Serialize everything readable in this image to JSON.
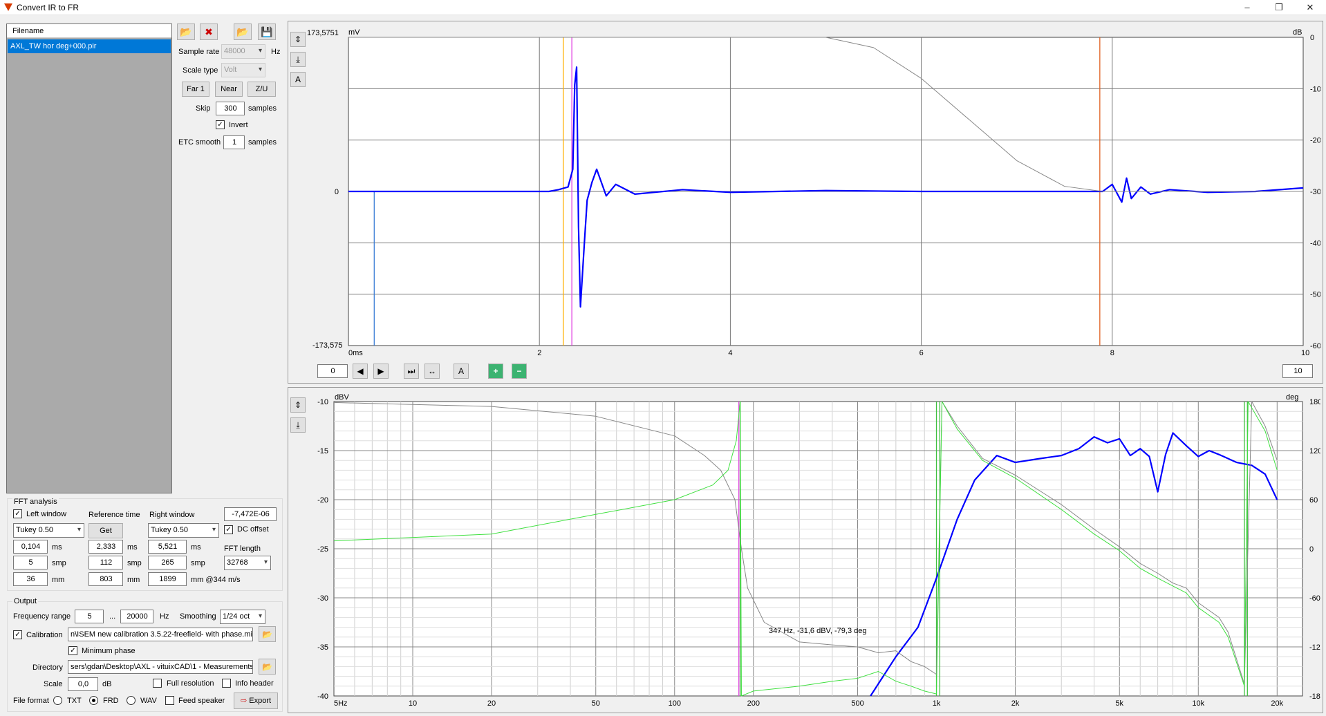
{
  "window": {
    "title": "Convert IR to FR",
    "min": "–",
    "restore": "❐",
    "close": "✕"
  },
  "file_list": {
    "header": "Filename",
    "items": [
      "AXL_TW hor deg+000.pir"
    ]
  },
  "toolbar": {
    "open": "📂",
    "remove": "✖",
    "open_folder": "📂",
    "save": "💾"
  },
  "params": {
    "sample_rate_label": "Sample rate",
    "sample_rate": "48000",
    "sample_rate_unit": "Hz",
    "scale_type_label": "Scale type",
    "scale_type": "Volt",
    "far1": "Far 1",
    "near": "Near",
    "zu": "Z/U",
    "skip_label": "Skip",
    "skip": "300",
    "skip_unit": "samples",
    "invert_label": "Invert",
    "invert_checked": true,
    "etc_label": "ETC smooth",
    "etc": "1",
    "etc_unit": "samples"
  },
  "fft": {
    "title": "FFT analysis",
    "left_window_label": "Left window",
    "left_window_checked": true,
    "reference_time_label": "Reference time",
    "right_window_label": "Right window",
    "dc_value": "-7,472E-06",
    "left_type": "Tukey 0.50",
    "get": "Get",
    "right_type": "Tukey 0.50",
    "dc_offset_label": "DC offset",
    "dc_offset_checked": true,
    "left_ms": "0,104",
    "ref_ms": "2,333",
    "right_ms": "5,521",
    "ms": "ms",
    "fft_length_label": "FFT length",
    "left_smp": "5",
    "ref_smp": "112",
    "right_smp": "265",
    "smp": "smp",
    "fft_length": "32768",
    "left_mm": "36",
    "ref_mm": "803",
    "right_mm": "1899",
    "mm": "mm",
    "mm_speed": "mm @344 m/s"
  },
  "output": {
    "title": "Output",
    "freq_range_label": "Frequency range",
    "freq_min": "5",
    "dots": "...",
    "freq_max": "20000",
    "hz": "Hz",
    "smoothing_label": "Smoothing",
    "smoothing": "1/24 oct",
    "calibration_label": "Calibration",
    "calibration_checked": true,
    "calibration_path": "n\\ISEM new calibration 3.5.22-freefield- with phase.mic",
    "min_phase_label": "Minimum phase",
    "min_phase_checked": true,
    "directory_label": "Directory",
    "directory": "sers\\gdan\\Desktop\\AXL - vituixCAD\\1 - Measurements",
    "scale_label": "Scale",
    "scale": "0,0",
    "db": "dB",
    "full_res_label": "Full resolution",
    "full_res_checked": false,
    "info_header_label": "Info header",
    "info_header_checked": false,
    "file_format_label": "File format",
    "formats": [
      "TXT",
      "FRD",
      "WAV"
    ],
    "format_selected": "FRD",
    "feed_speaker_label": "Feed speaker",
    "feed_speaker_checked": false,
    "export": "Export"
  },
  "ir_chart": {
    "left_axis_title": "mV",
    "right_axis_title": "dB",
    "y_top": "173,5751",
    "y_zero": "0",
    "y_bottom": "-173,575",
    "x_ticks": [
      "0ms",
      "2",
      "4",
      "6",
      "8",
      "10"
    ],
    "right_ticks": [
      "0",
      "-10",
      "-20",
      "-30",
      "-40",
      "-50",
      "-60"
    ],
    "nav_start": "0",
    "nav_end": "10",
    "btn_a": "A",
    "zoom_in": "+",
    "zoom_out": "−"
  },
  "fr_chart": {
    "left_axis_title": "dBV",
    "right_axis_title": "deg",
    "y_ticks": [
      "-10",
      "-15",
      "-20",
      "-25",
      "-30",
      "-35",
      "-40"
    ],
    "right_ticks": [
      "180",
      "120",
      "60",
      "0",
      "-60",
      "-120",
      "-180"
    ],
    "x_ticks": [
      "5Hz",
      "10",
      "20",
      "50",
      "100",
      "200",
      "500",
      "1k",
      "2k",
      "5k",
      "10k",
      "20k"
    ],
    "cursor_readout": "347 Hz, -31,6 dBV, -79,3 deg"
  },
  "chart_data": [
    {
      "type": "line",
      "ylabel": "mV",
      "y2label": "dB",
      "ylim": [
        -173.575,
        173.5751
      ],
      "xlim": [
        0,
        10
      ],
      "y2lim": [
        -60,
        0
      ],
      "x_ticks": [
        0,
        2,
        4,
        6,
        8,
        10
      ],
      "markers": [
        {
          "x": 0.27,
          "color": "#3a7bd5"
        },
        {
          "x": 2.25,
          "color": "#ffb000"
        },
        {
          "x": 2.34,
          "color": "#e040e0"
        },
        {
          "x": 7.87,
          "color": "#e06020"
        }
      ],
      "series": [
        {
          "color": "#0000ff",
          "x": [
            0,
            2.1,
            2.2,
            2.3,
            2.35,
            2.37,
            2.39,
            2.41,
            2.43,
            2.47,
            2.5,
            2.55,
            2.6,
            2.7,
            2.8,
            3.0,
            3.5,
            4.0,
            5.0,
            6.0,
            7.0,
            7.9,
            8.0,
            8.1,
            8.15,
            8.2,
            8.3,
            8.4,
            8.6,
            9.0,
            9.5,
            10.0
          ],
          "y": [
            0,
            0,
            2,
            5,
            25,
            120,
            140,
            -40,
            -130,
            -60,
            -10,
            10,
            25,
            -5,
            8,
            -3,
            2,
            -1,
            1,
            0,
            0,
            0,
            8,
            -12,
            15,
            -8,
            5,
            -3,
            2,
            -1,
            0,
            4
          ]
        },
        {
          "color": "#888888",
          "x": [
            0,
            5.0,
            5.5,
            6.0,
            6.5,
            7.0,
            7.5,
            7.9,
            10.0
          ],
          "y2": [
            0,
            0,
            -2,
            -8,
            -16,
            -24,
            -29,
            -30,
            -30
          ]
        }
      ]
    },
    {
      "type": "line",
      "ylabel": "dBV",
      "y2label": "deg",
      "ylim": [
        -40,
        -10
      ],
      "xlim": [
        5,
        25000
      ],
      "y2lim": [
        -180,
        180
      ],
      "x_scale": "log",
      "cursor": {
        "x": 347,
        "y": -31.6,
        "phase": -79.3
      },
      "markers": [
        {
          "x": 176,
          "color": "#e040e0"
        },
        {
          "x": 178,
          "color": "#40c040"
        },
        {
          "x": 1000,
          "color": "#40c040"
        },
        {
          "x": 1030,
          "color": "#40c040"
        },
        {
          "x": 15000,
          "color": "#40c040"
        },
        {
          "x": 15400,
          "color": "#40c040"
        }
      ],
      "series": [
        {
          "color": "#0000ff",
          "x": [
            560,
            700,
            850,
            1000,
            1200,
            1400,
            1700,
            2000,
            2500,
            3000,
            3500,
            4000,
            4500,
            5000,
            5500,
            6000,
            6500,
            7000,
            7500,
            8000,
            9000,
            10000,
            11000,
            12000,
            14000,
            16000,
            18000,
            20000
          ],
          "y": [
            -40,
            -36,
            -33,
            -28,
            -22,
            -18,
            -15.5,
            -16.2,
            -15.8,
            -15.5,
            -14.8,
            -13.6,
            -14.2,
            -13.8,
            -15.5,
            -14.8,
            -15.6,
            -19.2,
            -15.4,
            -13.2,
            -14.5,
            -15.6,
            -15.0,
            -15.4,
            -16.2,
            -16.5,
            -17.4,
            -20.0
          ]
        },
        {
          "color": "#888888",
          "x": [
            5,
            20,
            50,
            100,
            130,
            150,
            170,
            180,
            190,
            220,
            300,
            400,
            500,
            600,
            700,
            800,
            900,
            1000,
            1050,
            1200,
            1500,
            2000,
            3000,
            4000,
            5000,
            6000,
            7000,
            8000,
            9000,
            10000,
            12000,
            13000,
            15000,
            16000,
            18000,
            20000
          ],
          "y": [
            -10.1,
            -10.5,
            -11.5,
            -13.5,
            -15.5,
            -17.0,
            -20.0,
            -25.0,
            -29.0,
            -32.5,
            -34.5,
            -34.8,
            -35.0,
            -35.6,
            -35.4,
            -36.5,
            -37.0,
            -37.8,
            -10.0,
            -12.5,
            -15.8,
            -17.5,
            -20.5,
            -23.0,
            -24.8,
            -26.5,
            -27.5,
            -28.5,
            -29.0,
            -30.5,
            -32.0,
            -33.5,
            -38.8,
            -10.0,
            -12.5,
            -16.0
          ]
        },
        {
          "color": "#40e040",
          "x": [
            5,
            20,
            50,
            100,
            140,
            160,
            172,
            178,
            180,
            200,
            300,
            400,
            500,
            600,
            700,
            800,
            900,
            1000,
            1050,
            1200,
            1500,
            2000,
            3000,
            4000,
            5000,
            6000,
            7000,
            8000,
            9000,
            10000,
            12000,
            13000,
            15000,
            15500,
            18000,
            20000
          ],
          "y": [
            -24.2,
            -23.5,
            -21.5,
            -20.0,
            -18.5,
            -17.0,
            -14.0,
            -10.0,
            -40.0,
            -39.5,
            -39.0,
            -38.5,
            -38.2,
            -37.5,
            -38.5,
            -39.0,
            -39.5,
            -39.8,
            -10.0,
            -12.8,
            -16.0,
            -17.8,
            -21.0,
            -23.5,
            -25.2,
            -27.0,
            -28.0,
            -28.8,
            -29.5,
            -31.0,
            -32.5,
            -34.0,
            -39.0,
            -10.0,
            -13.0,
            -17.0
          ]
        }
      ]
    }
  ]
}
